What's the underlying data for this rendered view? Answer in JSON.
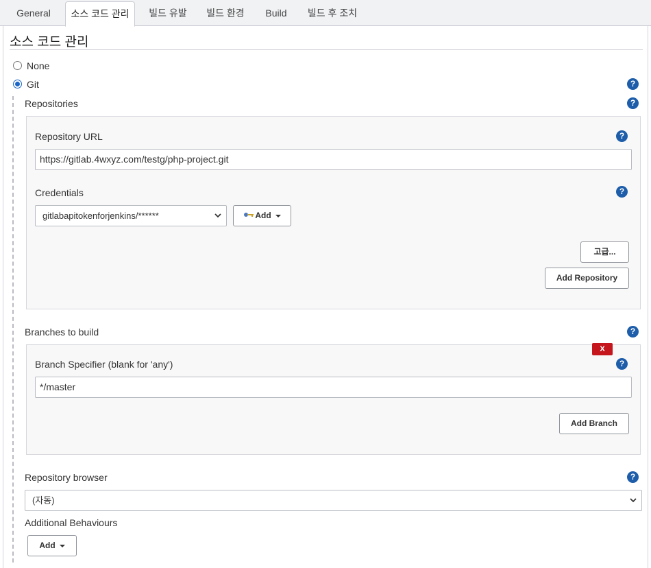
{
  "tabs": [
    {
      "label": "General"
    },
    {
      "label": "소스 코드 관리"
    },
    {
      "label": "빌드 유발"
    },
    {
      "label": "빌드 환경"
    },
    {
      "label": "Build"
    },
    {
      "label": "빌드 후 조치"
    }
  ],
  "active_tab": "소스 코드 관리",
  "section": {
    "title": "소스 코드 관리"
  },
  "scm": {
    "options": [
      {
        "label": "None",
        "selected": false
      },
      {
        "label": "Git",
        "selected": true
      }
    ]
  },
  "repositories": {
    "title": "Repositories",
    "url_label": "Repository URL",
    "url_value": "https://gitlab.4wxyz.com/testg/php-project.git",
    "credentials_label": "Credentials",
    "credentials_value": "gitlabapitokenforjenkins/******",
    "add_label": "Add",
    "advanced_label": "고급...",
    "add_repository_label": "Add Repository"
  },
  "branches": {
    "title": "Branches to build",
    "remove_label": "X",
    "specifier_label": "Branch Specifier (blank for 'any')",
    "specifier_value": "*/master",
    "add_branch_label": "Add Branch"
  },
  "repository_browser": {
    "label": "Repository browser",
    "value": "(자동)"
  },
  "additional_behaviours": {
    "label": "Additional Behaviours",
    "add_label": "Add"
  },
  "help_icon_glyph": "?",
  "colors": {
    "help_icon": "#1d5da9",
    "remove_button": "#c4161c",
    "radio_selected": "#1a66c7",
    "tabbar_bg": "#f1f2f4"
  }
}
